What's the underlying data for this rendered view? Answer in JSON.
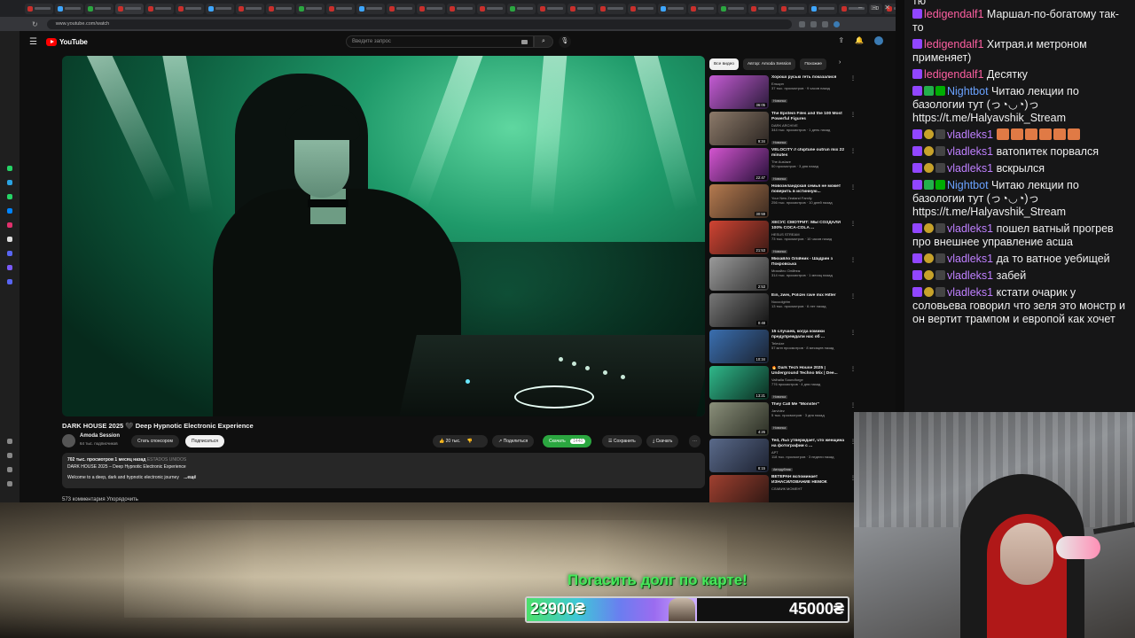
{
  "browser": {
    "url": "www.youtube.com/watch",
    "tab_labels": [
      "HD",
      "HD HD HD",
      "HD"
    ]
  },
  "youtube": {
    "logo": "YouTube",
    "search_placeholder": "Введите запрос",
    "video": {
      "title": "DARK HOUSE 2025 🖤 Deep Hypnotic Electronic Experience",
      "channel": "Amoda Session",
      "subscribers": "64 тыс. подписчиков",
      "sponsor_label": "Стать спонсором",
      "subscribe_label": "Подписаться",
      "likes": "20 тыс.",
      "share_label": "Поделиться",
      "download_green_label": "Скачать",
      "download_green_size": "1440",
      "save_label": "Сохранить",
      "download_label": "Скачать",
      "views_date": "702 тыс. просмотров  1 месяц назад",
      "country": "ESTADOS UNIDOS",
      "desc_line1": "DARK HOUSE 2025 – Deep Hypnotic Electronic Experience",
      "desc_line2": "Welcome to a deep, dark and hypnotic electronic journey",
      "more": "...ещё",
      "comments_peek": "573 комментария     Упорядочить"
    },
    "chips": [
      "Все видео",
      "Автор: Amoda Session",
      "Похожие"
    ],
    "recommendations": [
      {
        "title": "Хорошi руські геть показалися",
        "channel": "Ельцин",
        "meta": "37 тыс. просмотров · 9 часов назад",
        "badge": "Новинка",
        "duration": "36:05",
        "c1": "#c45bd3",
        "c2": "#2a1b3a"
      },
      {
        "title": "The Epstein Files and the 100 Most Powerful Figures",
        "channel": "DARK ARCHIVE",
        "meta": "344 тыс. просмотров · 1 день назад",
        "badge": "Новинка",
        "duration": "9:34",
        "c1": "#8c7a6a",
        "c2": "#2b2521"
      },
      {
        "title": "VELOCITY // chiptune outrun mix 22 minutes",
        "channel": "The Auslaze",
        "meta": "50 просмотров · 3 дня назад",
        "badge": "Новинка",
        "duration": "22:47",
        "c1": "#d455d0",
        "c2": "#251038"
      },
      {
        "title": "Новозеландская семья не может поверить в истинную...",
        "channel": "Your New Zealand Family",
        "meta": "256 тыс. просмотров · 10 дней назад",
        "badge": "",
        "duration": "30:59",
        "c1": "#b57a4f",
        "c2": "#3a2a20"
      },
      {
        "title": "ХЕСУС СМОТРИТ: МЫ СОЗДАЛИ 100% COCA-COLA ...",
        "channel": "HESUS STREAM",
        "meta": "73 тыс. просмотров · 10 часов назад",
        "badge": "Новинка",
        "duration": "21:53",
        "c1": "#d04433",
        "c2": "#3b1a15"
      },
      {
        "title": "Михайло Олійник - Шадрин з Покровська",
        "channel": "Михайло Олійник",
        "meta": "314 тыс. просмотров · 1 месяц назад",
        "badge": "",
        "duration": "2:53",
        "c1": "#9a9a9a",
        "c2": "#333"
      },
      {
        "title": "Ein, zwei, Polizei rave mix Hitler",
        "channel": "Nocoolgirlm",
        "meta": "13 тыс. просмотров · 6 лет назад",
        "badge": "",
        "duration": "0:48",
        "c1": "#777",
        "c2": "#111"
      },
      {
        "title": "15 случаев, когда комики предупреждали нас об ...",
        "channel": "Televize",
        "meta": "57 млн просмотров · 8 месяцев назад",
        "badge": "",
        "duration": "10:34",
        "c1": "#3a6fb0",
        "c2": "#1b2230"
      },
      {
        "title": "🔥 Dark Tech House 2025 | Underground Techno Mix | Dee...",
        "channel": "Valhalla Soundforge",
        "meta": "776 просмотров · 4 дня назад",
        "badge": "Новинка",
        "duration": "13:21",
        "c1": "#2fb88a",
        "c2": "#0b2c20"
      },
      {
        "title": "They Call Me \"Monster\"",
        "channel": "Jarvidez",
        "meta": "5 тыс. просмотров · 3 дня назад",
        "badge": "Новинка",
        "duration": "4:26",
        "c1": "#8a8f7a",
        "c2": "#2b2e24"
      },
      {
        "title": "Ted, Льо утверждает, что женщина на фотографии с ...",
        "channel": "АРТ",
        "meta": "118 тыс. просмотров · 3 недели назад",
        "badge": "Автодубляж",
        "duration": "8:15",
        "c1": "#5a6a8a",
        "c2": "#1c2130"
      },
      {
        "title": "ВЕТЕРАН вспоминает ИЗНАСИЛОВАНИЕ НЕМОК",
        "channel": "СЛАВИК МОМЕНТ",
        "meta": "",
        "badge": "",
        "duration": "",
        "c1": "#a04030",
        "c2": "#2a1612"
      }
    ]
  },
  "donation": {
    "title": "Погасить долг по карте!",
    "current": "23900₴",
    "goal": "45000₴",
    "progress": 0.53
  },
  "chat": {
    "cut_top": "тю",
    "messages": [
      {
        "user": "ledigendalf1",
        "text": "Маршал-по-богатому так-то",
        "color": "pink",
        "badges": [
          "sub"
        ],
        "emotes": 0
      },
      {
        "user": "ledigendalf1",
        "text": "Хитрая.и метроном применяет)",
        "color": "pink",
        "badges": [
          "sub"
        ],
        "emotes": 0
      },
      {
        "user": "ledigendalf1",
        "text": "Десятку",
        "color": "pink",
        "badges": [
          "sub"
        ],
        "emotes": 0
      },
      {
        "user": "Nightbot",
        "text": "Читаю лекции по базологии тут (っ◔◡◔)っ https://t.me/Halyavshik_Stream",
        "color": "blue",
        "badges": [
          "sub",
          "vip",
          "mod"
        ],
        "emotes": 0
      },
      {
        "user": "vladleks1",
        "text": "",
        "color": "purple",
        "badges": [
          "sub",
          "bits",
          "glitch"
        ],
        "emotes": 6
      },
      {
        "user": "vladleks1",
        "text": "ватопитек порвался",
        "color": "purple",
        "badges": [
          "sub",
          "bits",
          "glitch"
        ],
        "emotes": 0
      },
      {
        "user": "vladleks1",
        "text": "вскрылся",
        "color": "purple",
        "badges": [
          "sub",
          "bits",
          "glitch"
        ],
        "emotes": 0
      },
      {
        "user": "Nightbot",
        "text": "Читаю лекции по базологии тут (っ◔◡◔)っ https://t.me/Halyavshik_Stream",
        "color": "blue",
        "badges": [
          "sub",
          "vip",
          "mod"
        ],
        "emotes": 0
      },
      {
        "user": "vladleks1",
        "text": "пошел ватный прогрев про внешнее управление асша",
        "color": "purple",
        "badges": [
          "sub",
          "bits",
          "glitch"
        ],
        "emotes": 0
      },
      {
        "user": "vladleks1",
        "text": "да то ватное уебищей",
        "color": "purple",
        "badges": [
          "sub",
          "bits",
          "glitch"
        ],
        "emotes": 0
      },
      {
        "user": "vladleks1",
        "text": "забей",
        "color": "purple",
        "badges": [
          "sub",
          "bits",
          "glitch"
        ],
        "emotes": 0
      },
      {
        "user": "vladleks1",
        "text": "кстати очарик у соловьева говорил что зеля это монстр и он вертит трампом и европой как хочет",
        "color": "purple",
        "badges": [
          "sub",
          "bits",
          "glitch"
        ],
        "emotes": 0
      }
    ]
  }
}
